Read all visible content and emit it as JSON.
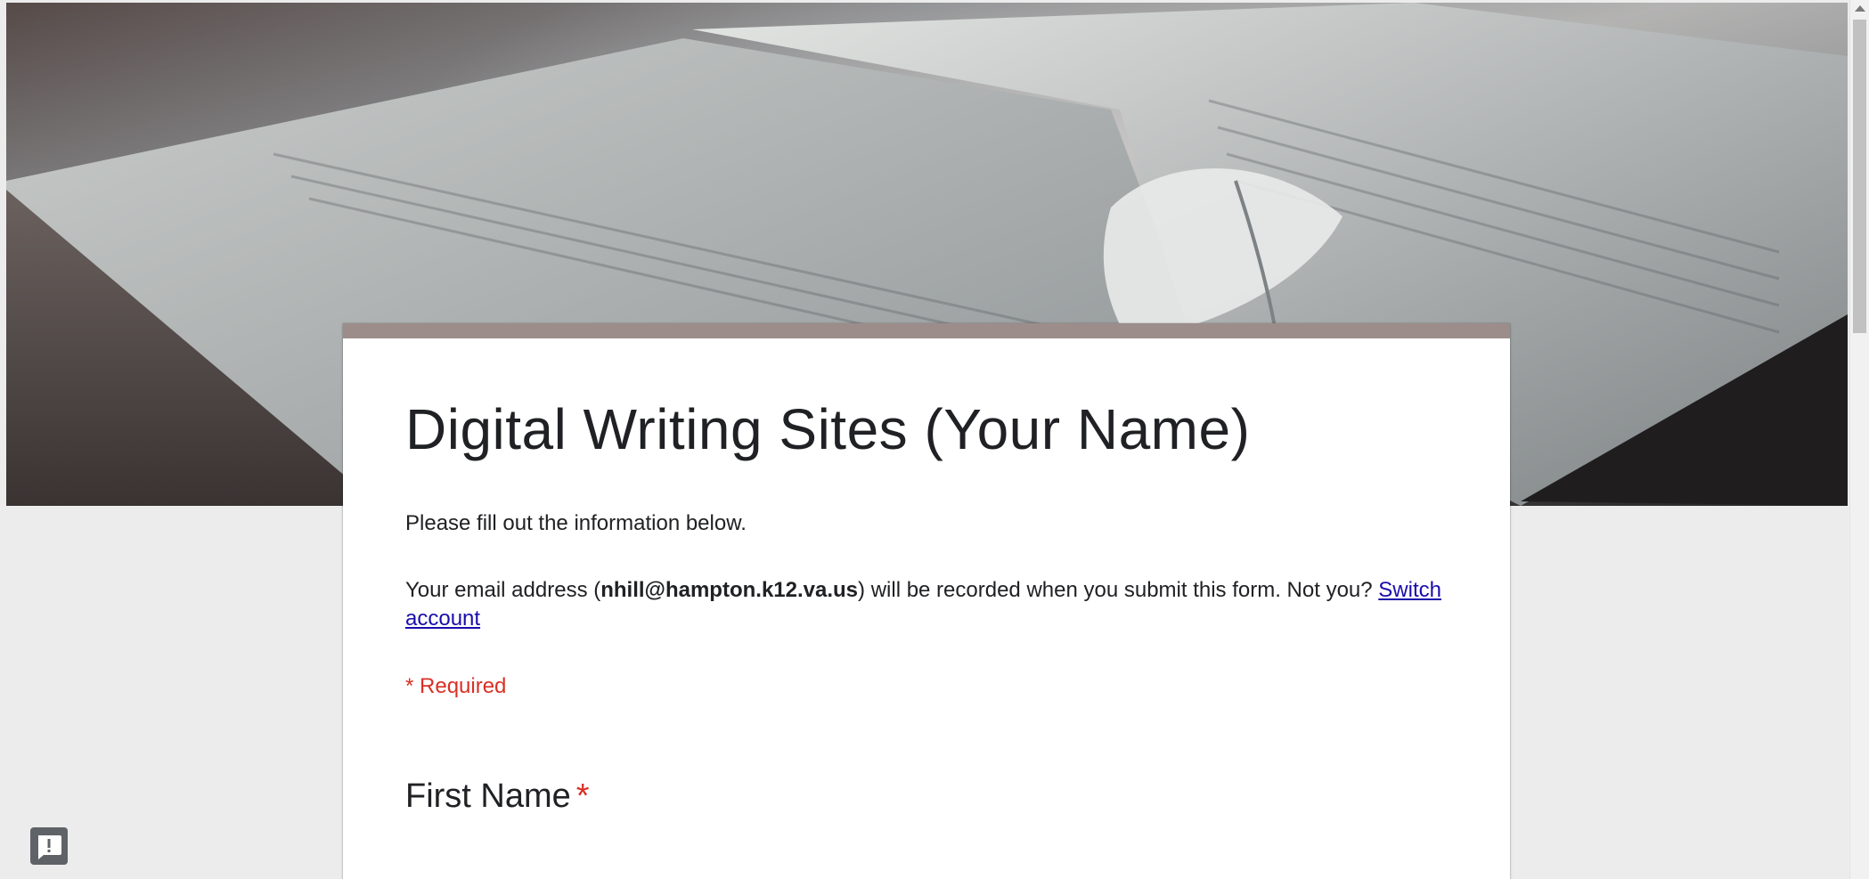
{
  "header": {
    "image": "open-book-with-quill-photo"
  },
  "form": {
    "title": "Digital Writing Sites (Your Name)",
    "description": "Please fill out the information below.",
    "email_notice": {
      "prefix": "Your email address (",
      "email": "nhill@hampton.k12.va.us",
      "suffix": ") will be recorded when you submit this form. Not you? ",
      "switch_account_label": "Switch account"
    },
    "required_note": "* Required",
    "questions": [
      {
        "title": "First Name",
        "required_marker": "*"
      }
    ]
  },
  "feedback": {
    "icon": "feedback-icon",
    "symbol": "!"
  },
  "colors": {
    "page_background": "#ececec",
    "card_accent": "#9c8d8b",
    "required": "#d93025",
    "link": "#1a0dab",
    "text": "#202124"
  }
}
